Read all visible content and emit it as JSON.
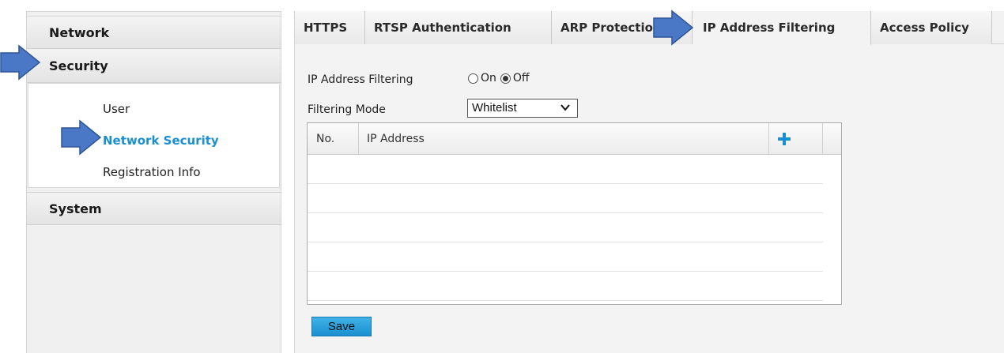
{
  "sidebar": {
    "sections": [
      {
        "label": "Network"
      },
      {
        "label": "Security"
      },
      {
        "label": "System"
      }
    ],
    "security_items": [
      {
        "label": "User"
      },
      {
        "label": "Network Security"
      },
      {
        "label": "Registration Info"
      }
    ]
  },
  "tabs": [
    {
      "label": "HTTPS"
    },
    {
      "label": "RTSP Authentication"
    },
    {
      "label": "ARP Protection"
    },
    {
      "label": "IP Address Filtering"
    },
    {
      "label": "Access Policy"
    }
  ],
  "form": {
    "ip_filter_label": "IP Address Filtering",
    "on_label": "On",
    "off_label": "Off",
    "selected": "Off",
    "mode_label": "Filtering Mode",
    "mode_value": "Whitelist"
  },
  "table": {
    "columns": [
      "No.",
      "IP Address"
    ],
    "rows": []
  },
  "save_label": "Save",
  "colors": {
    "accent": "#1a8fd0",
    "arrow": "#4a78c6",
    "plus": "#1a8fd0"
  },
  "icons": [
    "arrow-right-icon",
    "plus-icon",
    "chevron-down-icon",
    "radio-icon"
  ]
}
